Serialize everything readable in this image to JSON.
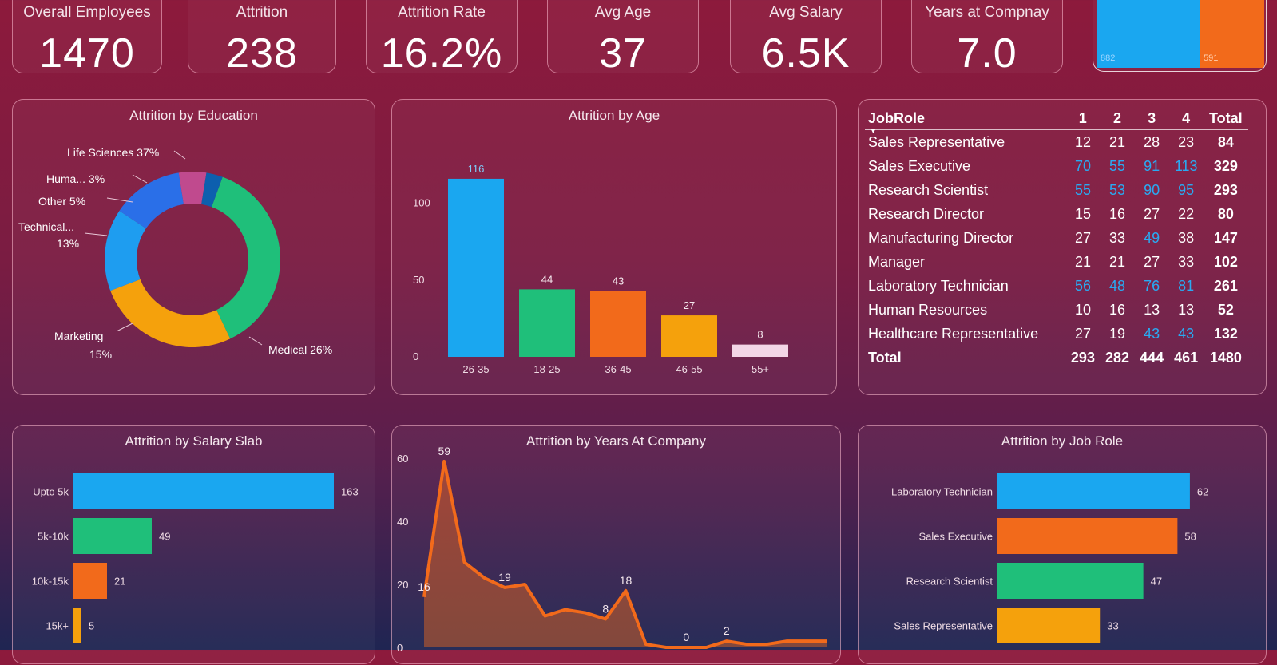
{
  "kpis": [
    {
      "label": "Overall Employees",
      "value": "1470"
    },
    {
      "label": "Attrition",
      "value": "238"
    },
    {
      "label": "Attrition Rate",
      "value": "16.2%"
    },
    {
      "label": "Avg Age",
      "value": "37"
    },
    {
      "label": "Avg Salary",
      "value": "6.5K"
    },
    {
      "label": "Years at Compnay",
      "value": "7.0"
    }
  ],
  "gender_tile": {
    "labels": [
      "882",
      "591"
    ],
    "colors": [
      "#1aa7f0",
      "#f26a1b"
    ]
  },
  "education": {
    "title": "Attrition by Education",
    "labels": [
      "Life Sciences 37%",
      "Huma... 3%",
      "Other 5%",
      "Technical...",
      "13%",
      "Marketing",
      "15%",
      "Medical 26%"
    ],
    "chart_data": {
      "type": "pie",
      "labels": [
        "Life Sciences",
        "Medical",
        "Marketing",
        "Technical Degree",
        "Other",
        "Human Resources"
      ],
      "values": [
        37,
        26,
        15,
        13,
        5,
        3
      ],
      "colors": [
        "#1fbf7a",
        "#f5a10c",
        "#1e9df0",
        "#2a6fe8",
        "#c04a8e",
        "#0d5fae"
      ]
    }
  },
  "age": {
    "title": "Attrition by Age",
    "ticks": [
      "100",
      "50",
      "0"
    ],
    "chart_data": {
      "type": "bar",
      "categories": [
        "26-35",
        "18-25",
        "36-45",
        "46-55",
        "55+"
      ],
      "values": [
        116,
        44,
        43,
        27,
        8
      ],
      "ylim": [
        0,
        130
      ],
      "colors": [
        "#1aa7f0",
        "#1fbf7a",
        "#f26a1b",
        "#f5a10c",
        "#f2d6e6"
      ]
    }
  },
  "matrix": {
    "headers": [
      "JobRole",
      "1",
      "2",
      "3",
      "4",
      "Total"
    ],
    "rows": [
      {
        "role": "Sales Representative",
        "v": [
          "12",
          "21",
          "28",
          "23"
        ],
        "total": "84",
        "hi": [
          false,
          false,
          false,
          false
        ]
      },
      {
        "role": "Sales Executive",
        "v": [
          "70",
          "55",
          "91",
          "113"
        ],
        "total": "329",
        "hi": [
          true,
          true,
          true,
          true
        ]
      },
      {
        "role": "Research Scientist",
        "v": [
          "55",
          "53",
          "90",
          "95"
        ],
        "total": "293",
        "hi": [
          true,
          true,
          true,
          true
        ]
      },
      {
        "role": "Research Director",
        "v": [
          "15",
          "16",
          "27",
          "22"
        ],
        "total": "80",
        "hi": [
          false,
          false,
          false,
          false
        ]
      },
      {
        "role": "Manufacturing Director",
        "v": [
          "27",
          "33",
          "49",
          "38"
        ],
        "total": "147",
        "hi": [
          false,
          false,
          true,
          false
        ]
      },
      {
        "role": "Manager",
        "v": [
          "21",
          "21",
          "27",
          "33"
        ],
        "total": "102",
        "hi": [
          false,
          false,
          false,
          false
        ]
      },
      {
        "role": "Laboratory Technician",
        "v": [
          "56",
          "48",
          "76",
          "81"
        ],
        "total": "261",
        "hi": [
          true,
          true,
          true,
          true
        ]
      },
      {
        "role": "Human Resources",
        "v": [
          "10",
          "16",
          "13",
          "13"
        ],
        "total": "52",
        "hi": [
          false,
          false,
          false,
          false
        ]
      },
      {
        "role": "Healthcare Representative",
        "v": [
          "27",
          "19",
          "43",
          "43"
        ],
        "total": "132",
        "hi": [
          false,
          false,
          true,
          true
        ]
      }
    ],
    "total_row": {
      "role": "Total",
      "v": [
        "293",
        "282",
        "444",
        "461"
      ],
      "total": "1480"
    }
  },
  "salary": {
    "title": "Attrition by Salary Slab",
    "chart_data": {
      "type": "bar",
      "categories": [
        "Upto 5k",
        "5k-10k",
        "10k-15k",
        "15k+"
      ],
      "values": [
        163,
        49,
        21,
        5
      ],
      "colors": [
        "#1aa7f0",
        "#1fbf7a",
        "#f26a1b",
        "#f5a10c"
      ],
      "xlim": [
        0,
        170
      ]
    }
  },
  "years": {
    "title": "Attrition by Years At Company",
    "ticks": [
      "60",
      "40",
      "20",
      "0"
    ],
    "chart_data": {
      "type": "area",
      "x": [
        0,
        1,
        2,
        3,
        4,
        5,
        6,
        7,
        8,
        9,
        10,
        11,
        12,
        13,
        14,
        15,
        16,
        17,
        18,
        19,
        20
      ],
      "y": [
        16,
        59,
        27,
        22,
        19,
        20,
        10,
        12,
        11,
        9,
        18,
        1,
        0,
        0,
        0,
        2,
        1,
        1,
        2,
        2,
        2
      ],
      "ylim": [
        0,
        60
      ],
      "labels": [
        {
          "i": 0,
          "text": "16"
        },
        {
          "i": 1,
          "text": "59"
        },
        {
          "i": 4,
          "text": "19"
        },
        {
          "i": 9,
          "text": "8"
        },
        {
          "i": 10,
          "text": "18"
        },
        {
          "i": 13,
          "text": "0"
        },
        {
          "i": 15,
          "text": "2"
        }
      ],
      "color": "#f26a1b"
    }
  },
  "jobrole": {
    "title": "Attrition by Job Role",
    "chart_data": {
      "type": "bar",
      "categories": [
        "Laboratory Technician",
        "Sales Executive",
        "Research Scientist",
        "Sales Representative"
      ],
      "values": [
        62,
        58,
        47,
        33
      ],
      "colors": [
        "#1aa7f0",
        "#f26a1b",
        "#1fbf7a",
        "#f5a10c"
      ],
      "xlim": [
        0,
        70
      ]
    }
  }
}
